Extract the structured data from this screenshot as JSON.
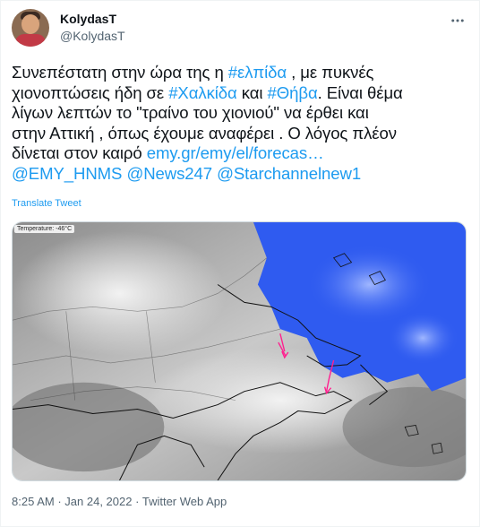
{
  "user": {
    "display_name": "KolydasT",
    "handle": "@KolydasT"
  },
  "tweet": {
    "line1_pre": "Συνεπέστατη στην ώρα της η ",
    "hashtag1": "#ελπίδα",
    "line1_post": " , με πυκνές",
    "line2_pre": "χιονοπτώσεις ήδη σε ",
    "hashtag2": "#Χαλκίδα",
    "line2_mid": " και ",
    "hashtag3": "#Θήβα",
    "line2_post": ". Είναι θέμα",
    "line3": "λίγων λεπτών το \"τραίνο του χιονιού\" να έρθει και",
    "line4": "στην Αττική , όπως έχουμε αναφέρει . Ο λόγος πλέον",
    "line5_pre": "δίνεται στον καιρό ",
    "link_url": "emy.gr/emy/el/forecas…",
    "mention1": "@EMY_HNMS",
    "mention2": "@News247",
    "mention3": "@Starchannelnew1"
  },
  "translate_label": "Translate Tweet",
  "media": {
    "overlay_label": "Temperature: -46°C"
  },
  "footer": {
    "time": "8:25 AM",
    "date": "Jan 24, 2022",
    "client": "Twitter Web App",
    "separator": "·"
  },
  "colors": {
    "link": "#1d9bf0",
    "text": "#0f1419",
    "secondary": "#536471",
    "snow_blue": "#2f5bf0"
  },
  "icons": [
    "more-icon"
  ]
}
